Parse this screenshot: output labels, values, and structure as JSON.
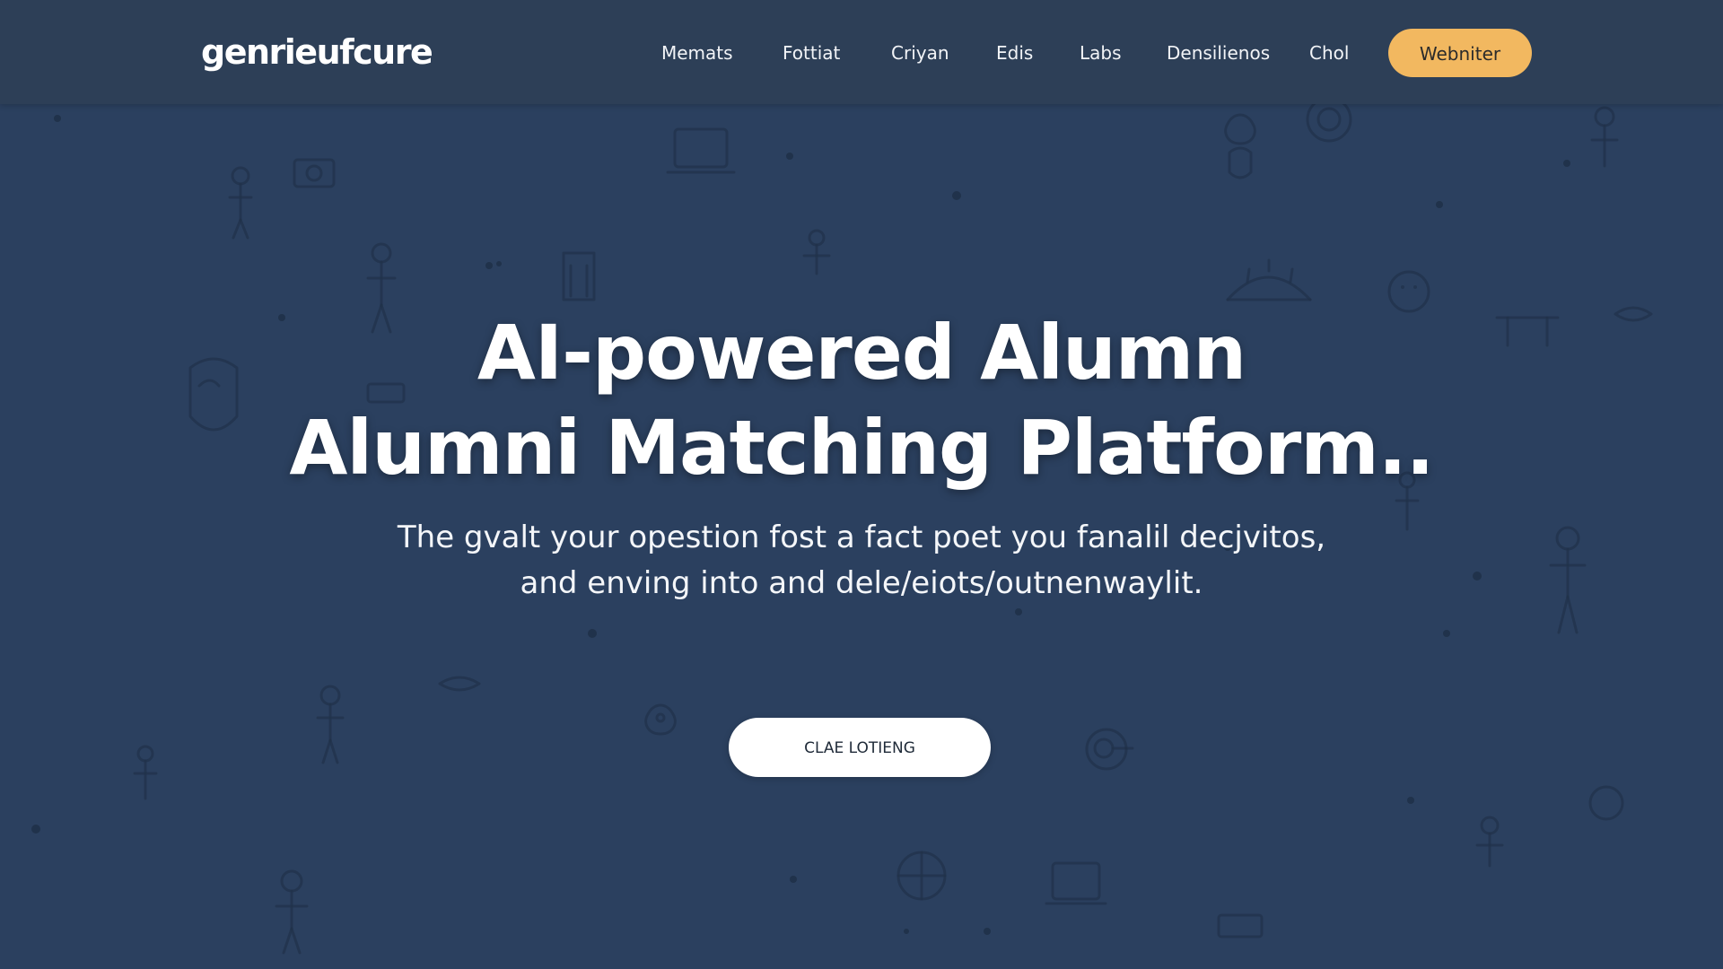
{
  "header": {
    "logo_text": "genrieufcure",
    "nav": [
      {
        "label": "Memats"
      },
      {
        "label": "Fottiat"
      },
      {
        "label": "Criyan"
      },
      {
        "label": "Edis"
      },
      {
        "label": "Labs"
      },
      {
        "label": "Densilienos"
      },
      {
        "label": "Chol"
      }
    ],
    "cta_label": "Webniter"
  },
  "hero": {
    "title_line1": "AI-powered Alumn",
    "title_line2": "Alumni Matching Platform..",
    "subtitle_line1": "The gvalt your opestion fost a fact poet you fanalil decjvitos,",
    "subtitle_line2": "and enving into and dele/eiots/outnenwaylit.",
    "cta_label": "CLAE LOTIENG"
  },
  "colors": {
    "background": "#2b405f",
    "header_bg": "#2d3f57",
    "accent": "#f2b860",
    "text": "#ffffff",
    "doodle": "#1d2d44"
  },
  "icons": [
    "person-doodle",
    "laptop-doodle",
    "camera-doodle",
    "location-pin-doodle",
    "globe-doodle",
    "chat-bubble-doodle",
    "graduation-cap-doodle"
  ]
}
